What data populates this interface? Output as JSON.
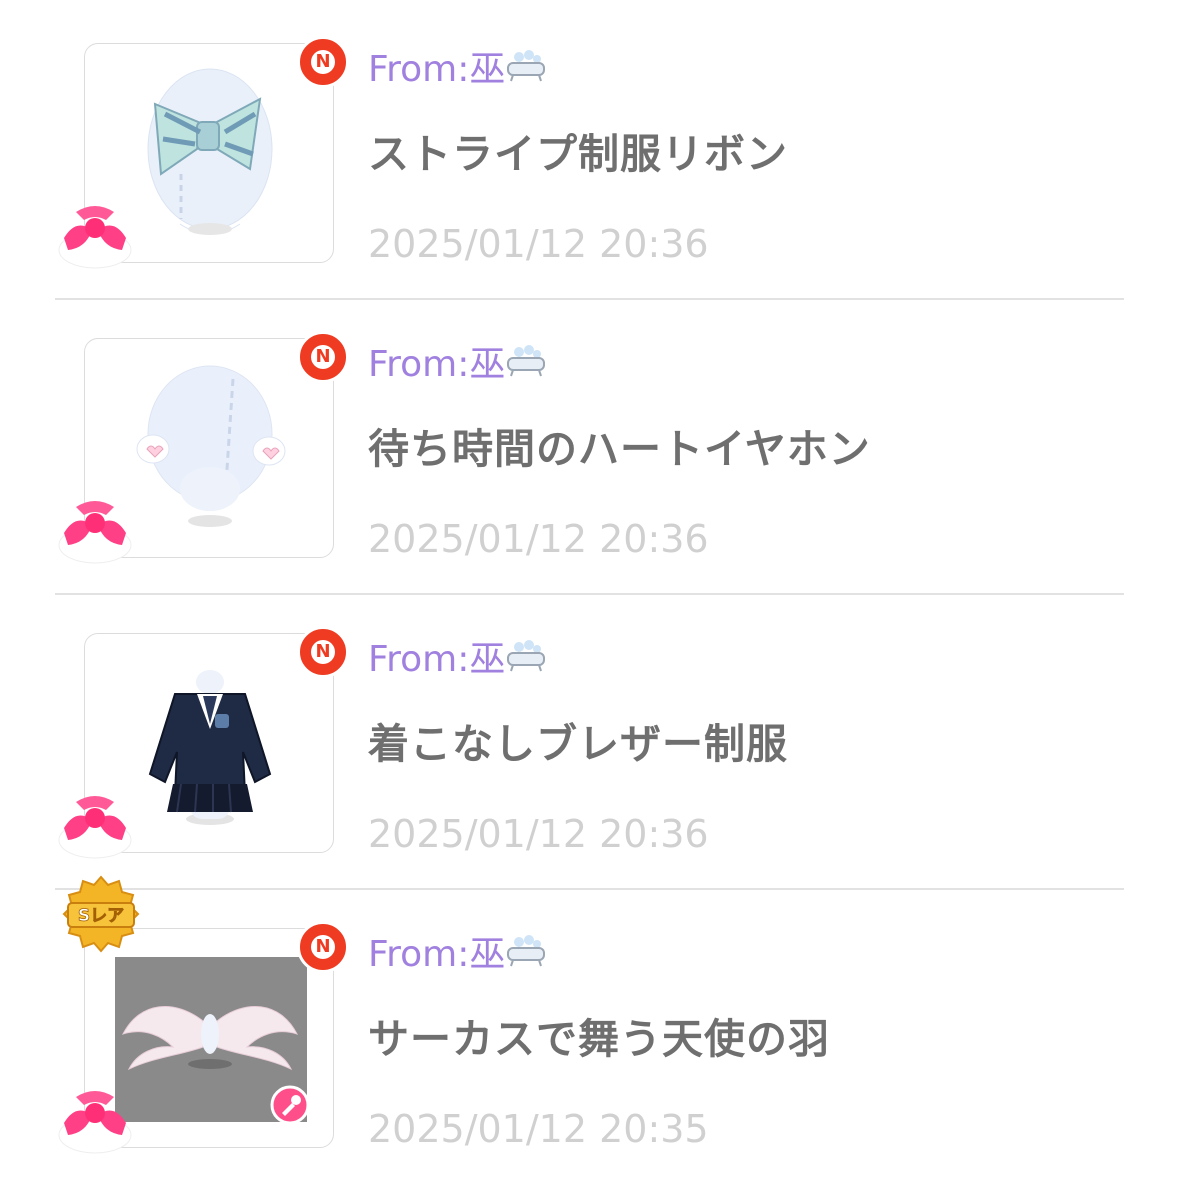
{
  "items": [
    {
      "sender": "From:巫",
      "sender_icon": "bathtub-icon",
      "title": "ストライプ制服リボン",
      "time": "2025/01/12 20:36",
      "badge": "N",
      "item_icon": "striped-ribbon",
      "rarity": ""
    },
    {
      "sender": "From:巫",
      "sender_icon": "bathtub-icon",
      "title": "待ち時間のハートイヤホン",
      "time": "2025/01/12 20:36",
      "badge": "N",
      "item_icon": "heart-earphones",
      "rarity": ""
    },
    {
      "sender": "From:巫",
      "sender_icon": "bathtub-icon",
      "title": "着こなしブレザー制服",
      "time": "2025/01/12 20:36",
      "badge": "N",
      "item_icon": "blazer-uniform",
      "rarity": ""
    },
    {
      "sender": "From:巫",
      "sender_icon": "bathtub-icon",
      "title": "サーカスで舞う天使の羽",
      "time": "2025/01/12 20:35",
      "badge": "N",
      "item_icon": "angel-wings",
      "rarity": "Sレア"
    }
  ],
  "colors": {
    "sender": "#a181df",
    "title": "#6f6f6f",
    "time": "#d0d0d0",
    "badge": "#ee3b22"
  }
}
